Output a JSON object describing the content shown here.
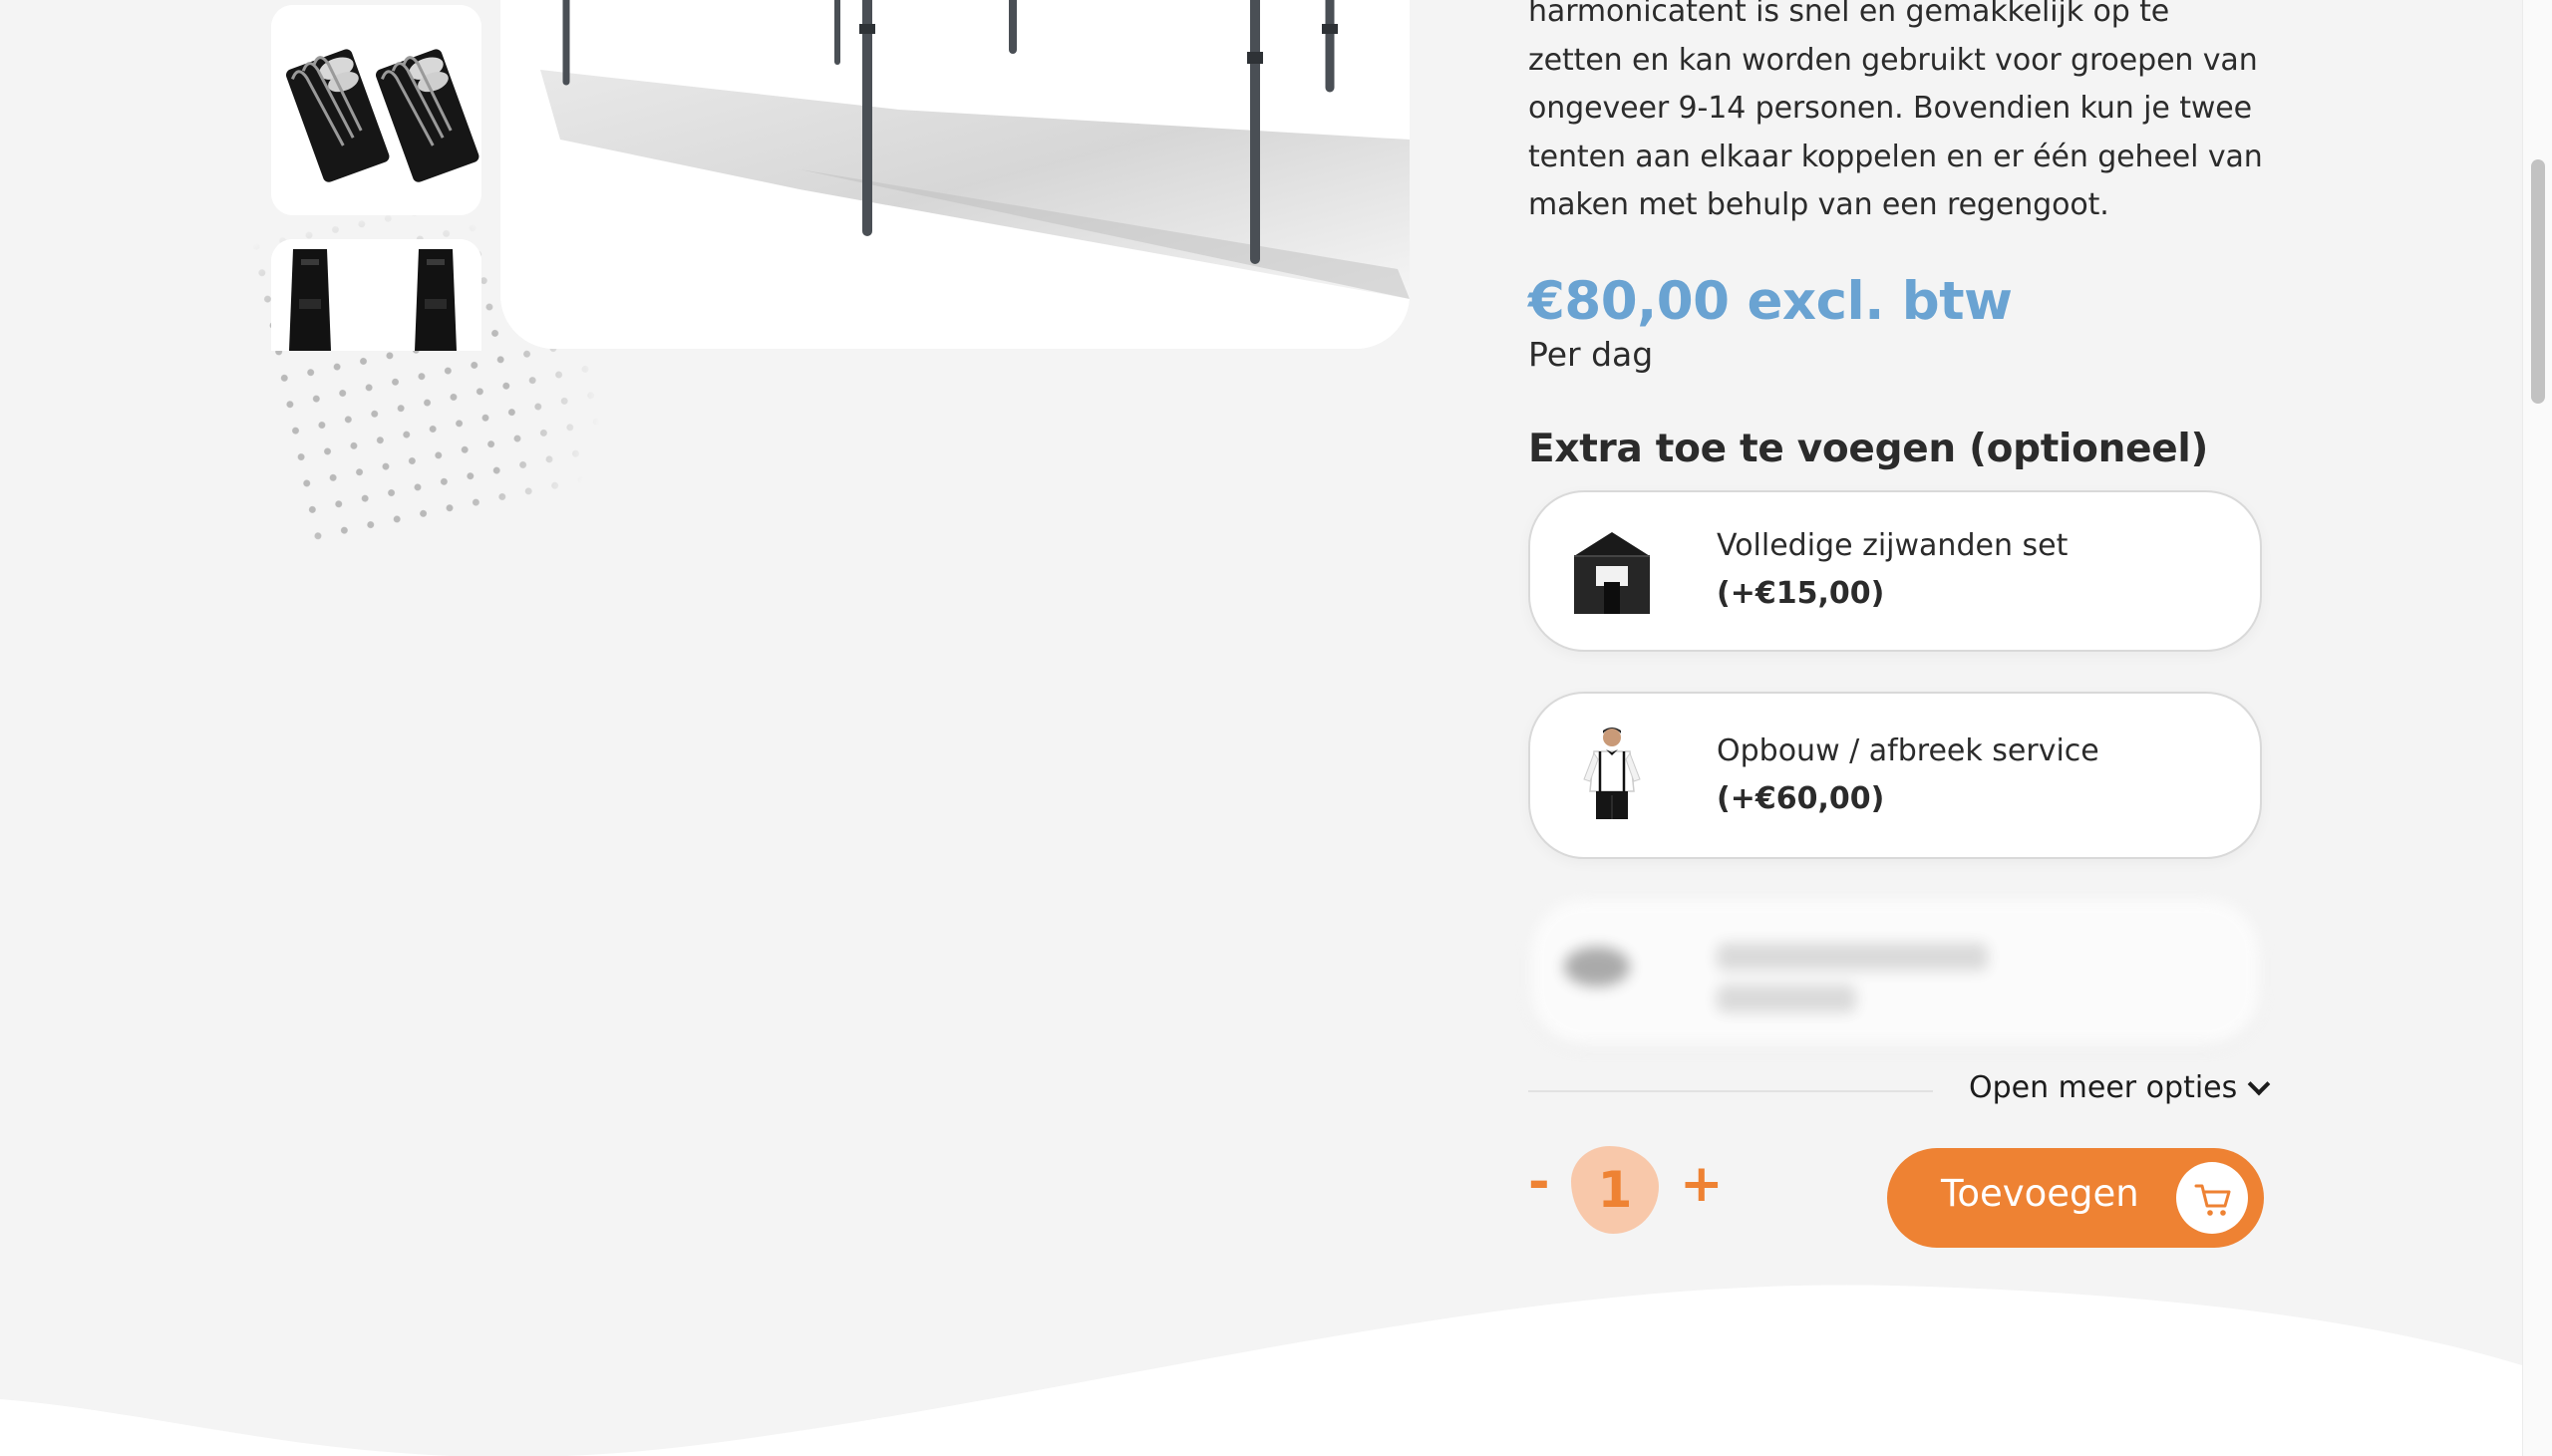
{
  "product": {
    "description": "harmonicatent is snel en gemakkelijk op te zetten en kan worden gebruikt voor groepen van ongeveer 9-14 personen. Bovendien kun je twee tenten aan elkaar koppelen en er één geheel van maken met behulp van een regengoot.",
    "price": "€80,00 excl. btw",
    "price_unit": "Per dag"
  },
  "extras": {
    "title": "Extra toe te voegen (optioneel)",
    "options": [
      {
        "name": "Volledige zijwanden set",
        "price": "(+€15,00)",
        "icon": "tent-sidewall-icon"
      },
      {
        "name": "Opbouw / afbreek service",
        "price": "(+€60,00)",
        "icon": "service-person-icon"
      }
    ],
    "more_label": "Open meer opties"
  },
  "cart": {
    "minus": "-",
    "quantity": "1",
    "plus": "+",
    "add_label": "Toevoegen",
    "cart_icon": "cart-icon"
  },
  "colors": {
    "accent": "#ee8233",
    "price": "#6aa3d2",
    "background": "#f4f4f4"
  }
}
